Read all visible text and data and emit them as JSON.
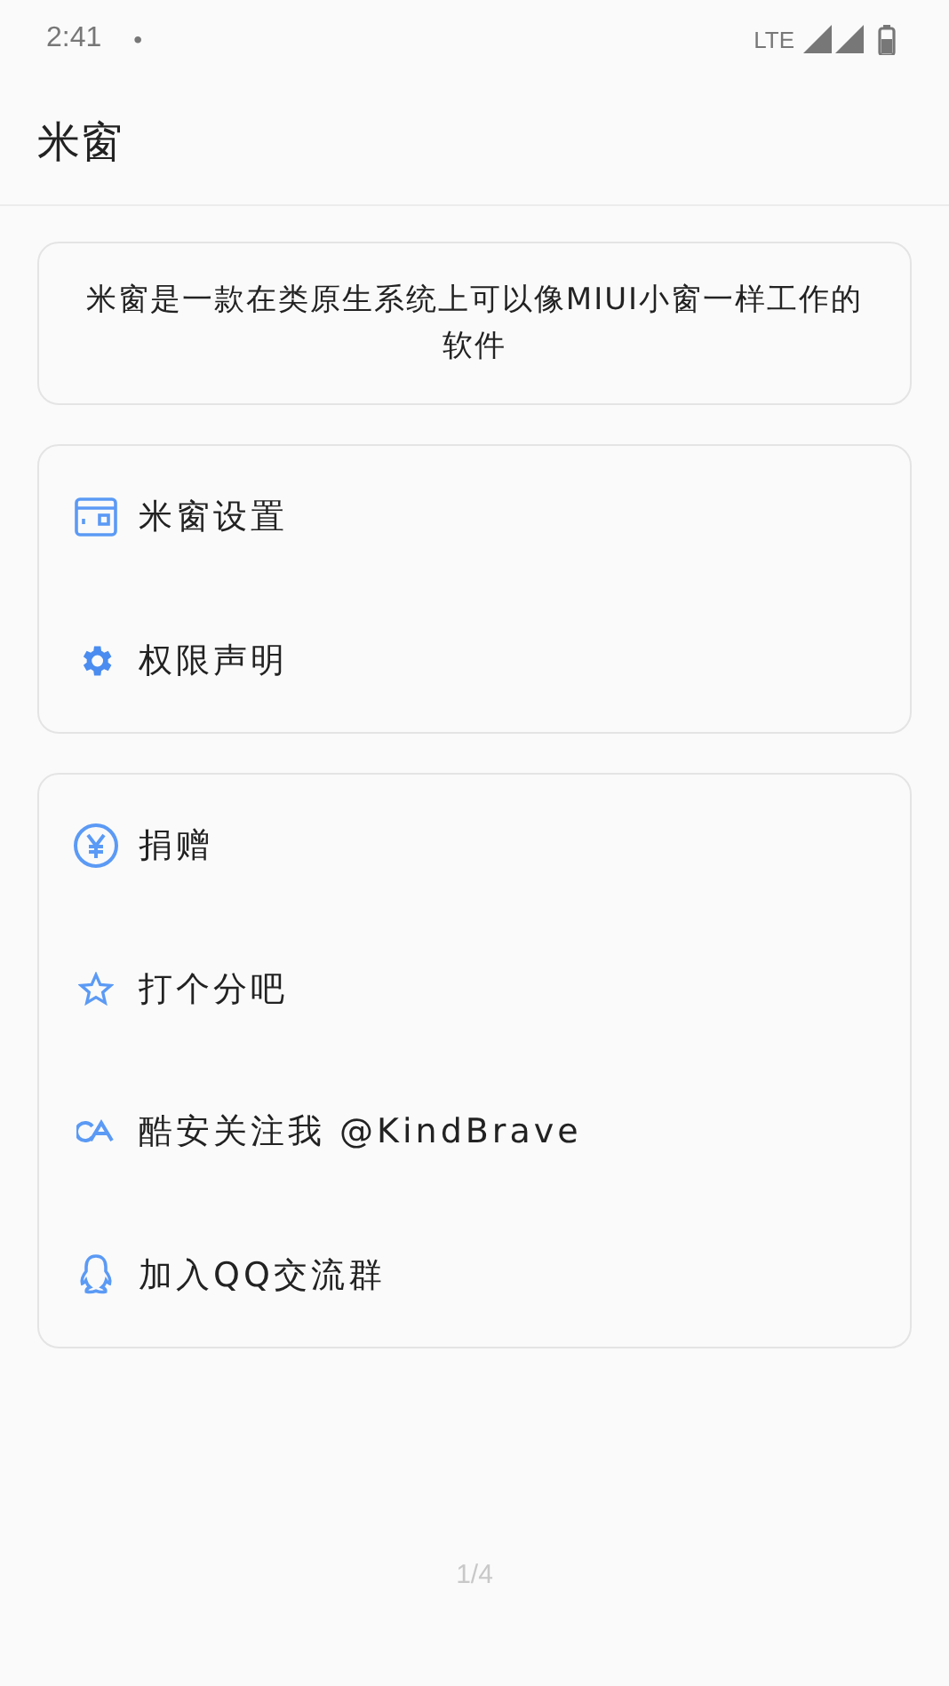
{
  "status_bar": {
    "time": "2:41",
    "dot": "•",
    "network": "LTE"
  },
  "app_bar": {
    "title": "米窗"
  },
  "intro": {
    "text": "米窗是一款在类原生系统上可以像MIUI小窗一样工作的软件"
  },
  "groups": [
    {
      "items": [
        {
          "label": "米窗设置"
        },
        {
          "label": "权限声明"
        }
      ]
    },
    {
      "items": [
        {
          "label": "捐赠"
        },
        {
          "label": "打个分吧"
        },
        {
          "label": "酷安关注我 @KindBrave"
        },
        {
          "label": "加入QQ交流群"
        }
      ]
    }
  ],
  "page_indicator": "1/4"
}
